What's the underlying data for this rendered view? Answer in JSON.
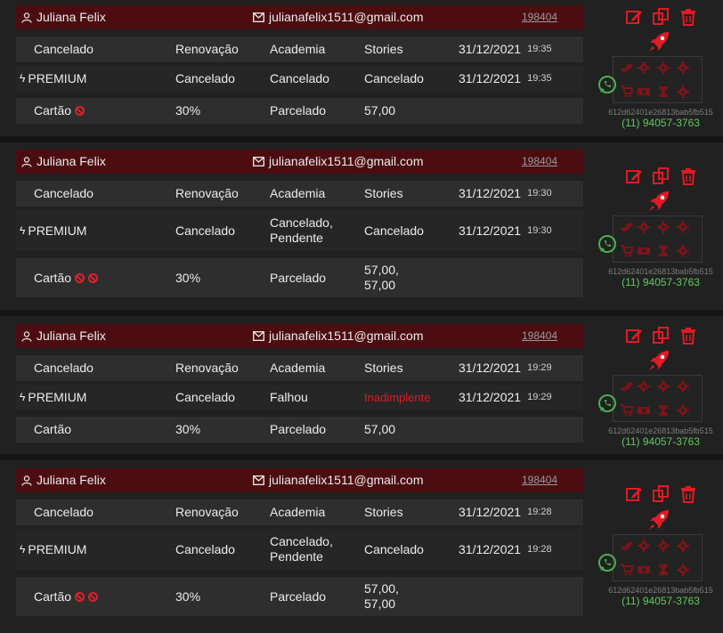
{
  "colors": {
    "accent": "#e01b24",
    "header": "#4c0d11",
    "whatsapp": "#4caf50"
  },
  "records": [
    {
      "user_name": "Juliana Felix",
      "email": "julianafelix1511@gmail.com",
      "id": "198404",
      "row1": {
        "status": "Cancelado",
        "type": "Renovação",
        "product": "Academia",
        "source": "Stories",
        "date": "31/12/2021",
        "time": "19:35"
      },
      "row2": {
        "plan": "PREMIUM",
        "status": "Cancelado",
        "payment_status": "Cancelado",
        "charge_status": "Cancelado",
        "date": "31/12/2021",
        "time": "19:35"
      },
      "row3": {
        "method": "Cartão",
        "blocked_count": 1,
        "discount": "30%",
        "mode": "Parcelado",
        "amount": "57,00"
      },
      "hash": "612d62401e26813bab5fb515",
      "phone": "(11) 94057-3763"
    },
    {
      "user_name": "Juliana Felix",
      "email": "julianafelix1511@gmail.com",
      "id": "198404",
      "row1": {
        "status": "Cancelado",
        "type": "Renovação",
        "product": "Academia",
        "source": "Stories",
        "date": "31/12/2021",
        "time": "19:30"
      },
      "row2": {
        "plan": "PREMIUM",
        "status": "Cancelado",
        "payment_status_l1": "Cancelado,",
        "payment_status_l2": "Pendente",
        "charge_status": "Cancelado",
        "date": "31/12/2021",
        "time": "19:30"
      },
      "row3": {
        "method": "Cartão",
        "blocked_count": 2,
        "discount": "30%",
        "mode": "Parcelado",
        "amount_l1": "57,00,",
        "amount_l2": "57,00"
      },
      "hash": "612d62401e26813bab5fb515",
      "phone": "(11) 94057-3763"
    },
    {
      "user_name": "Juliana Felix",
      "email": "julianafelix1511@gmail.com",
      "id": "198404",
      "row1": {
        "status": "Cancelado",
        "type": "Renovação",
        "product": "Academia",
        "source": "Stories",
        "date": "31/12/2021",
        "time": "19:29"
      },
      "row2": {
        "plan": "PREMIUM",
        "status": "Cancelado",
        "payment_status": "Falhou",
        "charge_status": "Inadimplente",
        "date": "31/12/2021",
        "time": "19:29"
      },
      "row3": {
        "method": "Cartão",
        "blocked_count": 0,
        "discount": "30%",
        "mode": "Parcelado",
        "amount": "57,00"
      },
      "hash": "612d62401e26813bab5fb515",
      "phone": "(11) 94057-3763"
    },
    {
      "user_name": "Juliana Felix",
      "email": "julianafelix1511@gmail.com",
      "id": "198404",
      "row1": {
        "status": "Cancelado",
        "type": "Renovação",
        "product": "Academia",
        "source": "Stories",
        "date": "31/12/2021",
        "time": "19:28"
      },
      "row2": {
        "plan": "PREMIUM",
        "status": "Cancelado",
        "payment_status_l1": "Cancelado,",
        "payment_status_l2": "Pendente",
        "charge_status": "Cancelado",
        "date": "31/12/2021",
        "time": "19:28"
      },
      "row3": {
        "method": "Cartão",
        "blocked_count": 2,
        "discount": "30%",
        "mode": "Parcelado",
        "amount_l1": "57,00,",
        "amount_l2": "57,00"
      },
      "hash": "612d62401e26813bab5fb515",
      "phone": "(11) 94057-3763"
    }
  ]
}
